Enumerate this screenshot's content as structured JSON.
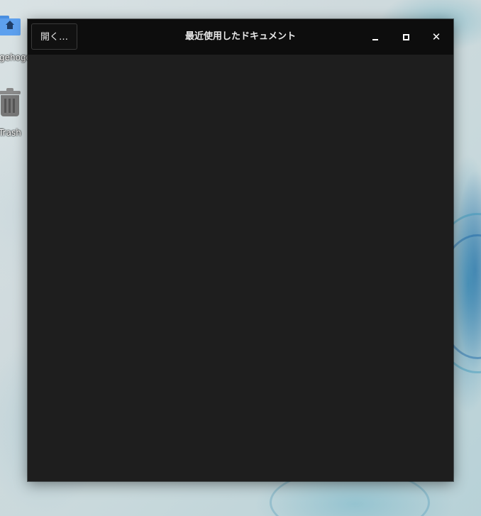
{
  "desktop": {
    "icons": [
      {
        "label": "hogehoge",
        "icon": "home-folder-icon"
      },
      {
        "label": "Trash",
        "icon": "trash-icon"
      }
    ]
  },
  "window": {
    "title": "最近使用したドキュメント",
    "open_button_label": "開く…",
    "controls": {
      "minimize": "minimize-icon",
      "maximize": "maximize-icon",
      "close": "close-icon",
      "close_glyph": "✕"
    }
  },
  "colors": {
    "titlebar": "#0d0d0d",
    "content_background": "#1e1e1e",
    "folder_blue": "#5da0ee"
  }
}
